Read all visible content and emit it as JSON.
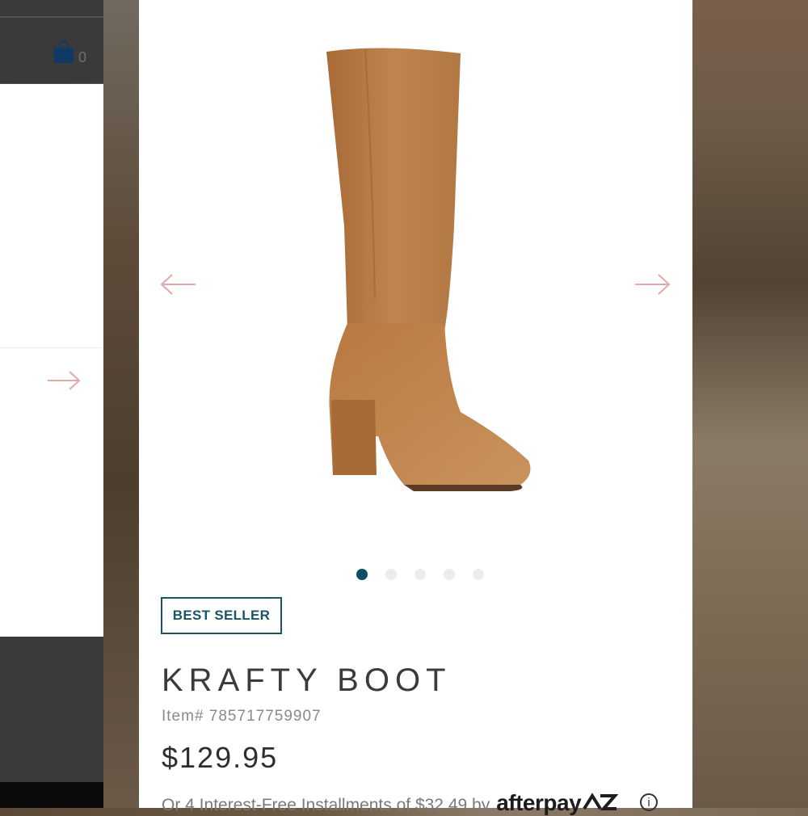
{
  "header": {
    "cart_count": "0"
  },
  "product": {
    "badge": "BEST SELLER",
    "name": "KRAFTY BOOT",
    "item_number": "Item# 785717759907",
    "price": "$129.95",
    "installment_text": "Or 4 Interest-Free Installments of $32.49 by",
    "afterpay_brand": "afterpay"
  },
  "gallery": {
    "image_count": 5,
    "active_index": 0
  },
  "icons": {
    "cart": "shopping-bag-icon",
    "prev": "arrow-left-icon",
    "next": "arrow-right-icon",
    "info": "info-icon"
  },
  "colors": {
    "accent": "#0b4f60",
    "badge_border": "#1a5567",
    "arrow": "#e2a9a9",
    "boot": "#b57a45"
  }
}
